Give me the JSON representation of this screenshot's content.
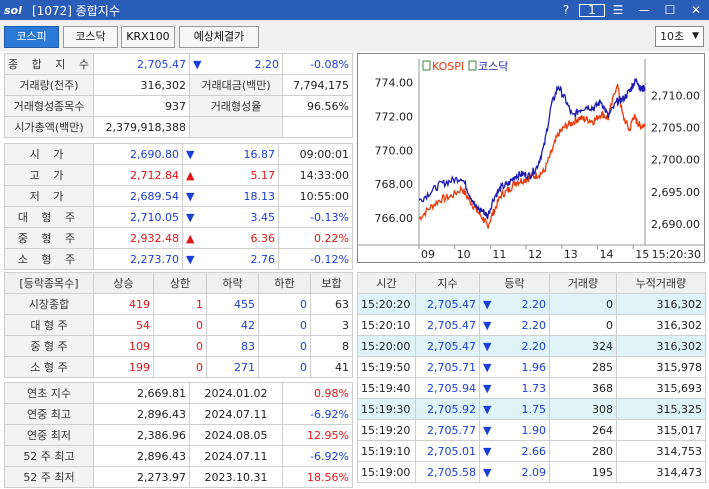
{
  "window": {
    "logo": "sol",
    "title": "[1072] 종합지수",
    "help": "?",
    "one": "1"
  },
  "tabs": [
    "코스피",
    "코스닥",
    "KRX100",
    "예상체결가"
  ],
  "interval": "10초",
  "summary": {
    "r1": {
      "label": "종 합 지 수",
      "value": "2,705.47",
      "change": "2.20",
      "pct": "-0.08%"
    },
    "r2": {
      "l1": "거래량(천주)",
      "v1": "316,302",
      "l2": "거래대금(백만)",
      "v2": "7,794,175"
    },
    "r3": {
      "l1": "거래형성종목수",
      "v1": "937",
      "l2": "거래형성율",
      "v2": "96.56%"
    },
    "r4": {
      "l1": "시가총액(백만)",
      "v1": "2,379,918,388"
    }
  },
  "prices": [
    {
      "label": "시 가",
      "value": "2,690.80",
      "arrow": "▼",
      "diff": "16.87",
      "extra": "09:00:01",
      "color": "blu",
      "dir": "dn"
    },
    {
      "label": "고 가",
      "value": "2,712.84",
      "arrow": "▲",
      "diff": "5.17",
      "extra": "14:33:00",
      "color": "red",
      "dir": "up"
    },
    {
      "label": "저 가",
      "value": "2,689.54",
      "arrow": "▼",
      "diff": "18.13",
      "extra": "10:55:00",
      "color": "blu",
      "dir": "dn"
    },
    {
      "label": "대 형 주",
      "value": "2,710.05",
      "arrow": "▼",
      "diff": "3.45",
      "extra": "-0.13%",
      "color": "blu",
      "dir": "dn"
    },
    {
      "label": "중 형 주",
      "value": "2,932.48",
      "arrow": "▲",
      "diff": "6.36",
      "extra": "0.22%",
      "color": "red",
      "dir": "up"
    },
    {
      "label": "소 형 주",
      "value": "2,273.70",
      "arrow": "▼",
      "diff": "2.76",
      "extra": "-0.12%",
      "color": "blu",
      "dir": "dn"
    }
  ],
  "breadth": {
    "headers": [
      "[등락종목수]",
      "상승",
      "상한",
      "하락",
      "하한",
      "보합"
    ],
    "rows": [
      [
        "시장종합",
        "419",
        "1",
        "455",
        "0",
        "63"
      ],
      [
        "대 형 주",
        "54",
        "0",
        "42",
        "0",
        "3"
      ],
      [
        "중 형 주",
        "109",
        "0",
        "83",
        "0",
        "8"
      ],
      [
        "소 형 주",
        "199",
        "0",
        "271",
        "0",
        "41"
      ]
    ]
  },
  "yearly": [
    {
      "label": "연초 지수",
      "value": "2,669.81",
      "date": "2024.01.02",
      "pct": "0.98%",
      "color": "red"
    },
    {
      "label": "연중 최고",
      "value": "2,896.43",
      "date": "2024.07.11",
      "pct": "-6.92%",
      "color": "blu"
    },
    {
      "label": "연중 최저",
      "value": "2,386.96",
      "date": "2024.08.05",
      "pct": "12.95%",
      "color": "red"
    },
    {
      "label": "52 주 최고",
      "value": "2,896.43",
      "date": "2024.07.11",
      "pct": "-6.92%",
      "color": "blu"
    },
    {
      "label": "52 주 최저",
      "value": "2,273.97",
      "date": "2023.10.31",
      "pct": "18.56%",
      "color": "red"
    }
  ],
  "ticks": {
    "headers": [
      "시간",
      "지수",
      "등락",
      "거래량",
      "누적거래량"
    ],
    "rows": [
      {
        "time": "15:20:20",
        "index": "2,705.47",
        "arrow": "▼",
        "chg": "2.20",
        "vol": "0",
        "cum": "316,302",
        "hl": true
      },
      {
        "time": "15:20:10",
        "index": "2,705.47",
        "arrow": "▼",
        "chg": "2.20",
        "vol": "0",
        "cum": "316,302",
        "hl": false
      },
      {
        "time": "15:20:00",
        "index": "2,705.47",
        "arrow": "▼",
        "chg": "2.20",
        "vol": "324",
        "cum": "316,302",
        "hl": true
      },
      {
        "time": "15:19:50",
        "index": "2,705.71",
        "arrow": "▼",
        "chg": "1.96",
        "vol": "285",
        "cum": "315,978",
        "hl": false
      },
      {
        "time": "15:19:40",
        "index": "2,705.94",
        "arrow": "▼",
        "chg": "1.73",
        "vol": "368",
        "cum": "315,693",
        "hl": false
      },
      {
        "time": "15:19:30",
        "index": "2,705.92",
        "arrow": "▼",
        "chg": "1.75",
        "vol": "308",
        "cum": "315,325",
        "hl": true
      },
      {
        "time": "15:19:20",
        "index": "2,705.77",
        "arrow": "▼",
        "chg": "1.90",
        "vol": "264",
        "cum": "315,017",
        "hl": false
      },
      {
        "time": "15:19:10",
        "index": "2,705.01",
        "arrow": "▼",
        "chg": "2.66",
        "vol": "280",
        "cum": "314,753",
        "hl": false
      },
      {
        "time": "15:19:00",
        "index": "2,705.58",
        "arrow": "▼",
        "chg": "2.09",
        "vol": "195",
        "cum": "314,473",
        "hl": false
      }
    ]
  },
  "chart_data": {
    "type": "line",
    "legend": [
      "KOSPI",
      "코스닥"
    ],
    "x_ticks": [
      "09",
      "10",
      "11",
      "12",
      "13",
      "14",
      "15",
      "15:20:30"
    ],
    "y_left_ticks": [
      "774.00",
      "772.00",
      "770.00",
      "768.00",
      "766.00"
    ],
    "y_left_range": [
      764.4,
      775.4
    ],
    "y_right_ticks": [
      "2,710.00",
      "2,705.00",
      "2,700.00",
      "2,695.00",
      "2,690.00"
    ],
    "y_right_range": [
      2686.7,
      2715.7
    ],
    "series": [
      {
        "name": "KOSPI",
        "axis": "right",
        "color": "#e83a0c",
        "x": [
          9.0,
          9.3,
          9.6,
          9.9,
          10.2,
          10.4,
          10.6,
          10.8,
          10.92,
          11.1,
          11.3,
          11.5,
          11.7,
          11.9,
          12.1,
          12.3,
          12.5,
          12.7,
          12.9,
          13.1,
          13.3,
          13.5,
          13.7,
          13.9,
          14.1,
          14.3,
          14.55,
          14.7,
          14.9,
          15.0,
          15.1,
          15.2,
          15.33
        ],
        "y": [
          2690.8,
          2692.5,
          2693.8,
          2694.3,
          2695.5,
          2693.8,
          2692.2,
          2690.8,
          2689.6,
          2692.0,
          2694.5,
          2695.2,
          2696.5,
          2696.8,
          2697.2,
          2697.6,
          2698.1,
          2701.0,
          2704.0,
          2705.2,
          2705.8,
          2706.5,
          2706.3,
          2706.0,
          2707.2,
          2706.5,
          2712.0,
          2707.0,
          2704.5,
          2706.8,
          2706.0,
          2705.2,
          2705.5
        ]
      },
      {
        "name": "코스닥",
        "axis": "left",
        "color": "#1c1ab0",
        "x": [
          9.0,
          9.3,
          9.6,
          9.9,
          10.2,
          10.4,
          10.6,
          10.8,
          10.92,
          11.1,
          11.3,
          11.5,
          11.7,
          11.9,
          12.1,
          12.3,
          12.5,
          12.7,
          12.9,
          13.1,
          13.3,
          13.5,
          13.7,
          13.9,
          14.1,
          14.3,
          14.55,
          14.7,
          14.9,
          15.0,
          15.1,
          15.2,
          15.33
        ],
        "y": [
          767.0,
          767.5,
          768.0,
          768.2,
          768.4,
          767.5,
          766.6,
          766.4,
          766.1,
          767.2,
          767.8,
          768.0,
          768.5,
          768.6,
          768.5,
          769.0,
          770.2,
          772.6,
          773.8,
          773.0,
          772.0,
          772.4,
          772.6,
          772.5,
          772.9,
          772.0,
          772.9,
          773.0,
          773.5,
          773.9,
          774.2,
          773.6,
          773.7
        ]
      }
    ]
  }
}
